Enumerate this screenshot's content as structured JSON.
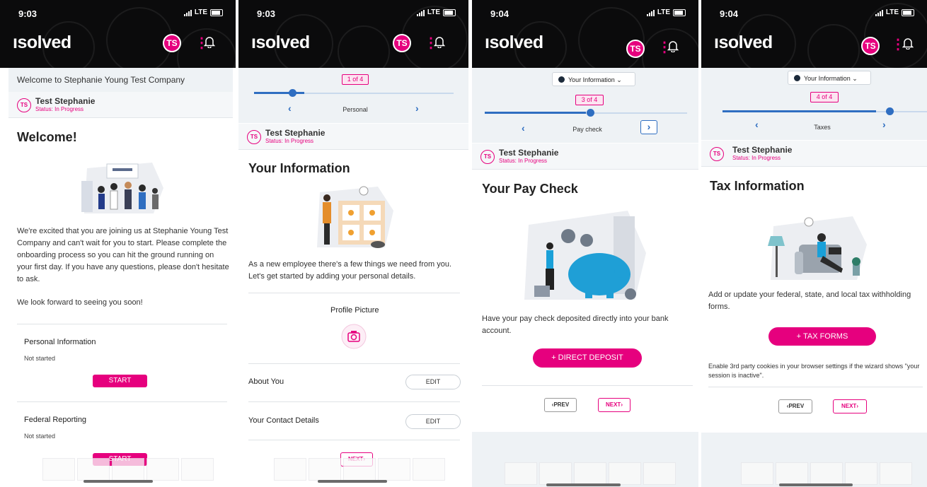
{
  "brand": {
    "logo_text": "ısolved",
    "accent": "#e6007e",
    "dark": "#0b0b0c",
    "blue": "#2f6ec1"
  },
  "screens": [
    {
      "time": "9:03",
      "network": "LTE",
      "avatar": "TS",
      "welcome_bar": "Welcome to Stephanie Young Test Company",
      "user": {
        "name": "Test Stephanie",
        "status": "Status: In Progress"
      },
      "heading": "Welcome!",
      "paragraph1": "We're excited that you are joining us at Stephanie Young Test Company and can't wait for you to start. Please complete the onboarding process so you can hit the ground running on your first day. If you have any questions, please don't hesitate to ask.",
      "paragraph2": "We look forward to seeing you soon!",
      "tasks": [
        {
          "title": "Personal Information",
          "status": "Not started",
          "button": "START"
        },
        {
          "title": "Federal Reporting",
          "status": "Not started",
          "button": "START"
        }
      ]
    },
    {
      "time": "9:03",
      "network": "LTE",
      "avatar": "TS",
      "step_count": "1 of 4",
      "step_label": "Personal",
      "step_progress": 0.25,
      "user": {
        "name": "Test Stephanie",
        "status": "Status: In Progress"
      },
      "heading": "Your Information",
      "paragraph": "As a new employee there's a few things we need from you. Let's get started by adding your personal details.",
      "profile_picture_label": "Profile Picture",
      "rows": [
        {
          "label": "About You",
          "button": "EDIT"
        },
        {
          "label": "Your Contact Details",
          "button": "EDIT"
        }
      ],
      "next_label": "NEXT"
    },
    {
      "time": "9:04",
      "network": "LTE",
      "avatar": "TS",
      "dropdown": "Your Information",
      "step_count": "3 of 4",
      "step_label": "Pay check",
      "step_progress": 0.5,
      "user": {
        "name": "Test Stephanie",
        "status": "Status: In Progress"
      },
      "heading": "Your Pay Check",
      "paragraph": "Have your pay check deposited directly into your bank account.",
      "action_button": "+ DIRECT DEPOSIT",
      "prev_label": "PREV",
      "next_label": "NEXT"
    },
    {
      "time": "9:04",
      "network": "LTE",
      "avatar": "TS",
      "dropdown": "Your Information",
      "step_count": "4 of 4",
      "step_label": "Taxes",
      "step_progress": 0.75,
      "user": {
        "name": "Test Stephanie",
        "status": "Status: In Progress"
      },
      "heading": "Tax Information",
      "paragraph": "Add or update your federal, state, and local tax withholding forms.",
      "action_button": "+ TAX FORMS",
      "note": "Enable 3rd party cookies in your browser settings if the wizard shows \"your session is inactive\".",
      "prev_label": "PREV",
      "next_label": "NEXT"
    }
  ]
}
